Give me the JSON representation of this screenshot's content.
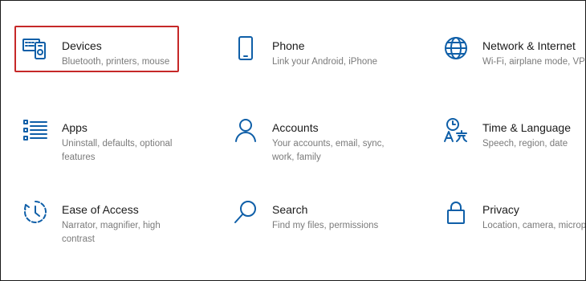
{
  "accent_color": "#0f5fa8",
  "selection_color": "#c62828",
  "tiles": [
    {
      "title": "Devices",
      "desc": "Bluetooth, printers, mouse",
      "icon": "devices-icon"
    },
    {
      "title": "Phone",
      "desc": "Link your Android, iPhone",
      "icon": "phone-icon"
    },
    {
      "title": "Network & Internet",
      "desc": "Wi-Fi, airplane mode, VPN",
      "icon": "globe-icon"
    },
    {
      "title": "Apps",
      "desc": "Uninstall, defaults, optional features",
      "icon": "apps-list-icon"
    },
    {
      "title": "Accounts",
      "desc": "Your accounts, email, sync, work, family",
      "icon": "person-icon"
    },
    {
      "title": "Time & Language",
      "desc": "Speech, region, date",
      "icon": "time-language-icon"
    },
    {
      "title": "Ease of Access",
      "desc": "Narrator, magnifier, high contrast",
      "icon": "ease-of-access-icon"
    },
    {
      "title": "Search",
      "desc": "Find my files, permissions",
      "icon": "search-icon"
    },
    {
      "title": "Privacy",
      "desc": "Location, camera, microphone",
      "icon": "lock-icon"
    }
  ]
}
